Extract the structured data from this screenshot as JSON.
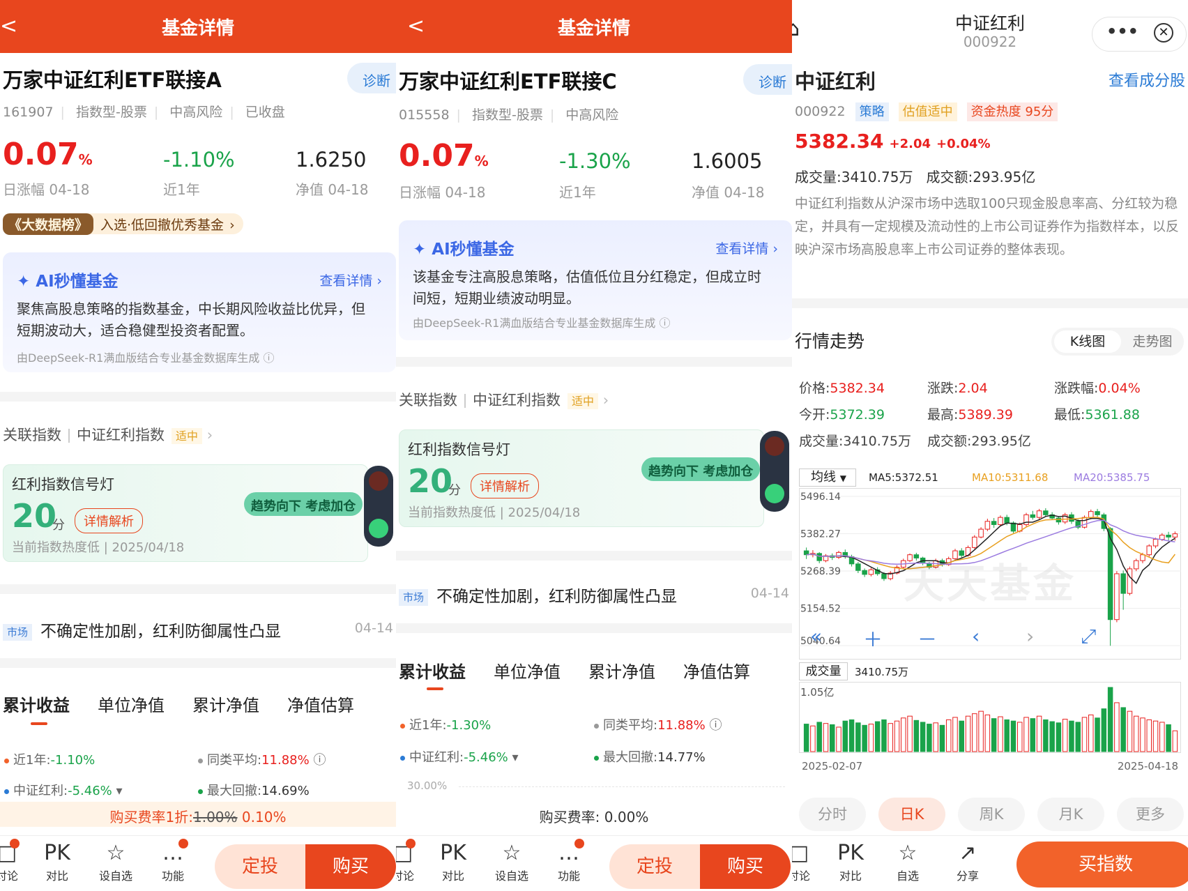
{
  "fundA": {
    "header": {
      "back": "<",
      "title": "基金详情"
    },
    "name": "万家中证红利ETF联接A",
    "diagnose": "诊断",
    "code": "161907",
    "type": "指数型-股票",
    "risk": "中高风险",
    "status": "已收盘",
    "daily_change_value": "0.07",
    "daily_change_unit": "%",
    "daily_change_label": "日涨幅 04-18",
    "year_change": "-1.10%",
    "year_label": "近1年",
    "nav": "1.6250",
    "nav_label": "净值 04-18",
    "rank_tag": "《大数据榜》",
    "rank_text": "入选·低回撤优秀基金",
    "ai": {
      "title": "AI秒懂基金",
      "more": "查看详情",
      "body": "聚焦高股息策略的指数基金，中长期风险收益比优异，但短期波动大，适合稳健型投资者配置。",
      "source": "由DeepSeek-R1满血版结合专业基金数据库生成"
    },
    "assoc": {
      "label": "关联指数",
      "index": "中证红利指数",
      "tag": "适中"
    },
    "signal": {
      "title": "红利指数信号灯",
      "score": "20",
      "unit": "分",
      "detail": "详情解析",
      "foot": "当前指数热度低 | 2025/04/18",
      "bubble": "趋势向下 考虑加仓"
    },
    "news": {
      "tag": "市场",
      "title": "不确定性加剧，红利防御属性凸显",
      "date": "04-14"
    },
    "tabs": [
      "累计收益",
      "单位净值",
      "累计净值",
      "净值估算"
    ],
    "stats": {
      "s1_label": "近1年:",
      "s1_value": "-1.10%",
      "s2_label": "同类平均:",
      "s2_value": "11.88%",
      "s3_label": "中证红利:",
      "s3_value": "-5.46%",
      "s4_label": "最大回撤:",
      "s4_value": "14.69%"
    },
    "fee": {
      "label": "购买费率1折:",
      "old": "1.00%",
      "new": "0.10%"
    },
    "nav_items": [
      "讨论",
      "对比",
      "设自选",
      "功能"
    ],
    "nav_icons": [
      "□",
      "PK",
      "☆",
      "…"
    ],
    "btn_plan": "定投",
    "btn_buy": "购买"
  },
  "fundC": {
    "header": {
      "back": "<",
      "title": "基金详情"
    },
    "name": "万家中证红利ETF联接C",
    "diagnose": "诊断",
    "code": "015558",
    "type": "指数型-股票",
    "risk": "中高风险",
    "daily_change_value": "0.07",
    "daily_change_unit": "%",
    "daily_change_label": "日涨幅 04-18",
    "year_change": "-1.30%",
    "year_label": "近1年",
    "nav": "1.6005",
    "nav_label": "净值 04-18",
    "ai": {
      "title": "AI秒懂基金",
      "more": "查看详情",
      "body": "该基金专注高股息策略，估值低位且分红稳定，但成立时间短，短期业绩波动明显。",
      "source": "由DeepSeek-R1满血版结合专业基金数据库生成"
    },
    "assoc": {
      "label": "关联指数",
      "index": "中证红利指数",
      "tag": "适中"
    },
    "signal": {
      "title": "红利指数信号灯",
      "score": "20",
      "unit": "分",
      "detail": "详情解析",
      "foot": "当前指数热度低 | 2025/04/18",
      "bubble": "趋势向下 考虑加仓"
    },
    "news": {
      "tag": "市场",
      "title": "不确定性加剧，红利防御属性凸显",
      "date": "04-14"
    },
    "tabs": [
      "累计收益",
      "单位净值",
      "累计净值",
      "净值估算"
    ],
    "stats": {
      "s1_label": "近1年:",
      "s1_value": "-1.30%",
      "s2_label": "同类平均:",
      "s2_value": "11.88%",
      "s3_label": "中证红利:",
      "s3_value": "-5.46%",
      "s4_label": "最大回撤:",
      "s4_value": "14.77%"
    },
    "axis_top": "30.00%",
    "fee": {
      "label": "购买费率:",
      "value": "0.00%"
    },
    "nav_items": [
      "讨论",
      "对比",
      "设自选",
      "功能"
    ],
    "nav_icons": [
      "□",
      "PK",
      "☆",
      "…"
    ],
    "btn_plan": "定投",
    "btn_buy": "购买"
  },
  "index": {
    "title": "中证红利",
    "code": "000922",
    "name": "中证红利",
    "components": "查看成分股",
    "tag_strategy": "策略",
    "tag_valuation": "估值适中",
    "tag_heat": "资金热度 95分",
    "price": "5382.34",
    "change": "+2.04",
    "change_pct": "+0.04%",
    "volume_line": "成交量:3410.75万",
    "amount_line": "成交额:293.95亿",
    "desc": "中证红利指数从沪深市场中选取100只现金股息率高、分红较为稳定，并具有一定规模及流动性的上市公司证券作为指数样本，以反映沪深市场高股息率上市公司证券的整体表现。",
    "trend_title": "行情走势",
    "kline_tab": "K线图",
    "trend_tab": "走势图",
    "quote": {
      "price_label": "价格:",
      "price": "5382.34",
      "chg_label": "涨跌:",
      "chg": "2.04",
      "pct_label": "涨跌幅:",
      "pct": "0.04%",
      "open_label": "今开:",
      "open": "5372.39",
      "high_label": "最高:",
      "high": "5389.39",
      "low_label": "最低:",
      "low": "5361.88",
      "vol_label": "成交量:",
      "vol": "3410.75万",
      "amt_label": "成交额:",
      "amt": "293.95亿"
    },
    "ma_select": "均线",
    "ma5": "MA5:5372.51",
    "ma10": "MA10:5311.68",
    "ma20": "MA20:5385.75",
    "y_labels": [
      "5496.14",
      "5382.27",
      "5268.39",
      "5154.52",
      "5040.64"
    ],
    "watermark": "天天基金",
    "vol_select": "成交量",
    "vol_value": "3410.75万",
    "vol_max": "1.05亿",
    "date_start": "2025-02-07",
    "date_end": "2025-04-18",
    "periods": [
      "分时",
      "日K",
      "周K",
      "月K",
      "更多"
    ],
    "nav_items": [
      "讨论",
      "对比",
      "自选",
      "分享"
    ],
    "nav_icons": [
      "□",
      "PK",
      "☆",
      "↗"
    ],
    "buy_index": "买指数",
    "colors": {
      "up": "#e8201e",
      "down": "#1aa34a",
      "ma5": "#222222",
      "ma10": "#e8a020",
      "ma20": "#9b7be0"
    }
  },
  "chart_data": {
    "type": "candlestick",
    "title": "",
    "ylim": [
      5040.64,
      5496.14
    ],
    "x_range": [
      "2025-02-07",
      "2025-04-18"
    ],
    "candles": [
      [
        5330,
        5318,
        5340,
        5305
      ],
      [
        5318,
        5322,
        5332,
        5310
      ],
      [
        5322,
        5300,
        5326,
        5292
      ],
      [
        5300,
        5315,
        5320,
        5295
      ],
      [
        5315,
        5310,
        5322,
        5302
      ],
      [
        5310,
        5325,
        5330,
        5305
      ],
      [
        5325,
        5312,
        5334,
        5306
      ],
      [
        5312,
        5290,
        5318,
        5282
      ],
      [
        5290,
        5270,
        5296,
        5262
      ],
      [
        5270,
        5258,
        5276,
        5250
      ],
      [
        5258,
        5272,
        5278,
        5252
      ],
      [
        5272,
        5260,
        5280,
        5254
      ],
      [
        5260,
        5245,
        5265,
        5238
      ],
      [
        5245,
        5262,
        5268,
        5240
      ],
      [
        5262,
        5280,
        5286,
        5258
      ],
      [
        5280,
        5300,
        5306,
        5276
      ],
      [
        5300,
        5318,
        5322,
        5296
      ],
      [
        5318,
        5308,
        5324,
        5300
      ],
      [
        5308,
        5292,
        5312,
        5286
      ],
      [
        5292,
        5280,
        5296,
        5274
      ],
      [
        5280,
        5300,
        5306,
        5276
      ],
      [
        5300,
        5288,
        5306,
        5282
      ],
      [
        5288,
        5306,
        5312,
        5284
      ],
      [
        5306,
        5330,
        5336,
        5302
      ],
      [
        5330,
        5316,
        5338,
        5310
      ],
      [
        5316,
        5340,
        5346,
        5312
      ],
      [
        5340,
        5372,
        5378,
        5336
      ],
      [
        5372,
        5396,
        5402,
        5368
      ],
      [
        5396,
        5420,
        5428,
        5390
      ],
      [
        5420,
        5410,
        5430,
        5400
      ],
      [
        5410,
        5432,
        5438,
        5404
      ],
      [
        5432,
        5415,
        5440,
        5408
      ],
      [
        5415,
        5390,
        5420,
        5384
      ],
      [
        5390,
        5410,
        5416,
        5386
      ],
      [
        5410,
        5440,
        5446,
        5404
      ],
      [
        5440,
        5432,
        5452,
        5425
      ],
      [
        5432,
        5452,
        5458,
        5426
      ],
      [
        5452,
        5440,
        5460,
        5434
      ],
      [
        5440,
        5430,
        5448,
        5424
      ],
      [
        5430,
        5418,
        5436,
        5410
      ],
      [
        5418,
        5440,
        5446,
        5412
      ],
      [
        5440,
        5420,
        5448,
        5412
      ],
      [
        5420,
        5402,
        5426,
        5396
      ],
      [
        5402,
        5432,
        5438,
        5398
      ],
      [
        5432,
        5450,
        5456,
        5426
      ],
      [
        5450,
        5440,
        5458,
        5432
      ],
      [
        5440,
        5398,
        5446,
        5390
      ],
      [
        5398,
        5120,
        5402,
        5040
      ],
      [
        5120,
        5260,
        5268,
        5112
      ],
      [
        5260,
        5200,
        5270,
        5150
      ],
      [
        5200,
        5275,
        5282,
        5194
      ],
      [
        5275,
        5300,
        5306,
        5268
      ],
      [
        5300,
        5318,
        5324,
        5292
      ],
      [
        5318,
        5345,
        5350,
        5312
      ],
      [
        5345,
        5365,
        5370,
        5338
      ],
      [
        5365,
        5378,
        5384,
        5360
      ],
      [
        5378,
        5372,
        5388,
        5362
      ],
      [
        5372,
        5382,
        5389,
        5361
      ]
    ],
    "volumes": [
      0.45,
      0.42,
      0.48,
      0.46,
      0.44,
      0.4,
      0.5,
      0.52,
      0.47,
      0.43,
      0.45,
      0.49,
      0.52,
      0.46,
      0.5,
      0.55,
      0.58,
      0.51,
      0.48,
      0.45,
      0.47,
      0.43,
      0.52,
      0.56,
      0.5,
      0.58,
      0.62,
      0.66,
      0.6,
      0.54,
      0.57,
      0.52,
      0.5,
      0.48,
      0.56,
      0.54,
      0.58,
      0.52,
      0.49,
      0.47,
      0.53,
      0.5,
      0.48,
      0.56,
      0.6,
      0.55,
      0.7,
      1.05,
      0.8,
      0.72,
      0.66,
      0.58,
      0.55,
      0.52,
      0.5,
      0.48,
      0.44,
      0.34
    ]
  }
}
